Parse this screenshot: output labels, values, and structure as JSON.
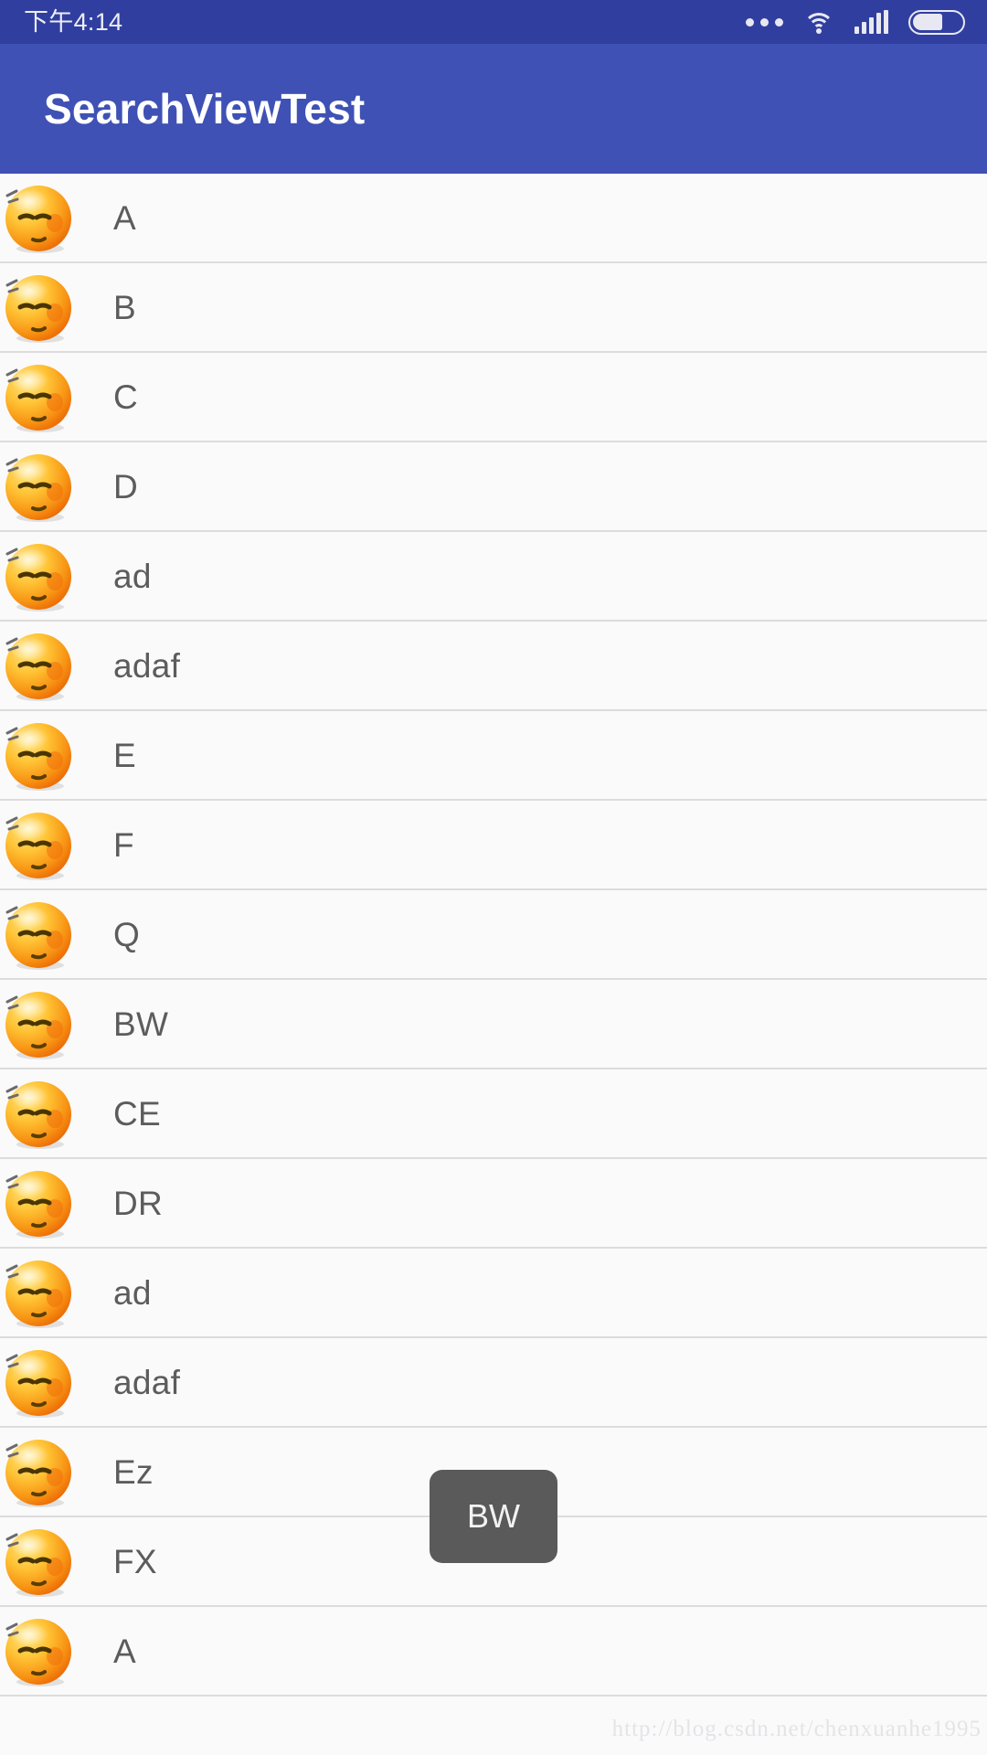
{
  "status_bar": {
    "time": "下午4:14",
    "icons": [
      "more-dots-icon",
      "wifi-icon",
      "signal-icon",
      "battery-icon"
    ],
    "battery_level_percent": 62,
    "background_color": "#303F9F",
    "foreground_color": "#E8E8F2"
  },
  "app_bar": {
    "title": "SearchViewTest",
    "background_color": "#3F51B5",
    "title_color": "#FFFFFF"
  },
  "list": {
    "avatar_icon": "smiley-face-avatar",
    "row_background": "#FAFAFA",
    "divider_color": "#DCDCDC",
    "label_color": "#5C5C5C",
    "items": [
      {
        "label": "A"
      },
      {
        "label": "B"
      },
      {
        "label": "C"
      },
      {
        "label": "D"
      },
      {
        "label": "ad"
      },
      {
        "label": "adaf"
      },
      {
        "label": "E"
      },
      {
        "label": "F"
      },
      {
        "label": "Q"
      },
      {
        "label": "BW"
      },
      {
        "label": "CE"
      },
      {
        "label": "DR"
      },
      {
        "label": "ad"
      },
      {
        "label": "adaf"
      },
      {
        "label": "Ez"
      },
      {
        "label": "FX"
      },
      {
        "label": "A"
      }
    ]
  },
  "toast": {
    "message": "BW",
    "background_color": "#5A5A5A",
    "text_color": "#F2F2F2"
  },
  "watermark": {
    "text": "http://blog.csdn.net/chenxuanhe1995",
    "color": "#E4E4E8"
  }
}
